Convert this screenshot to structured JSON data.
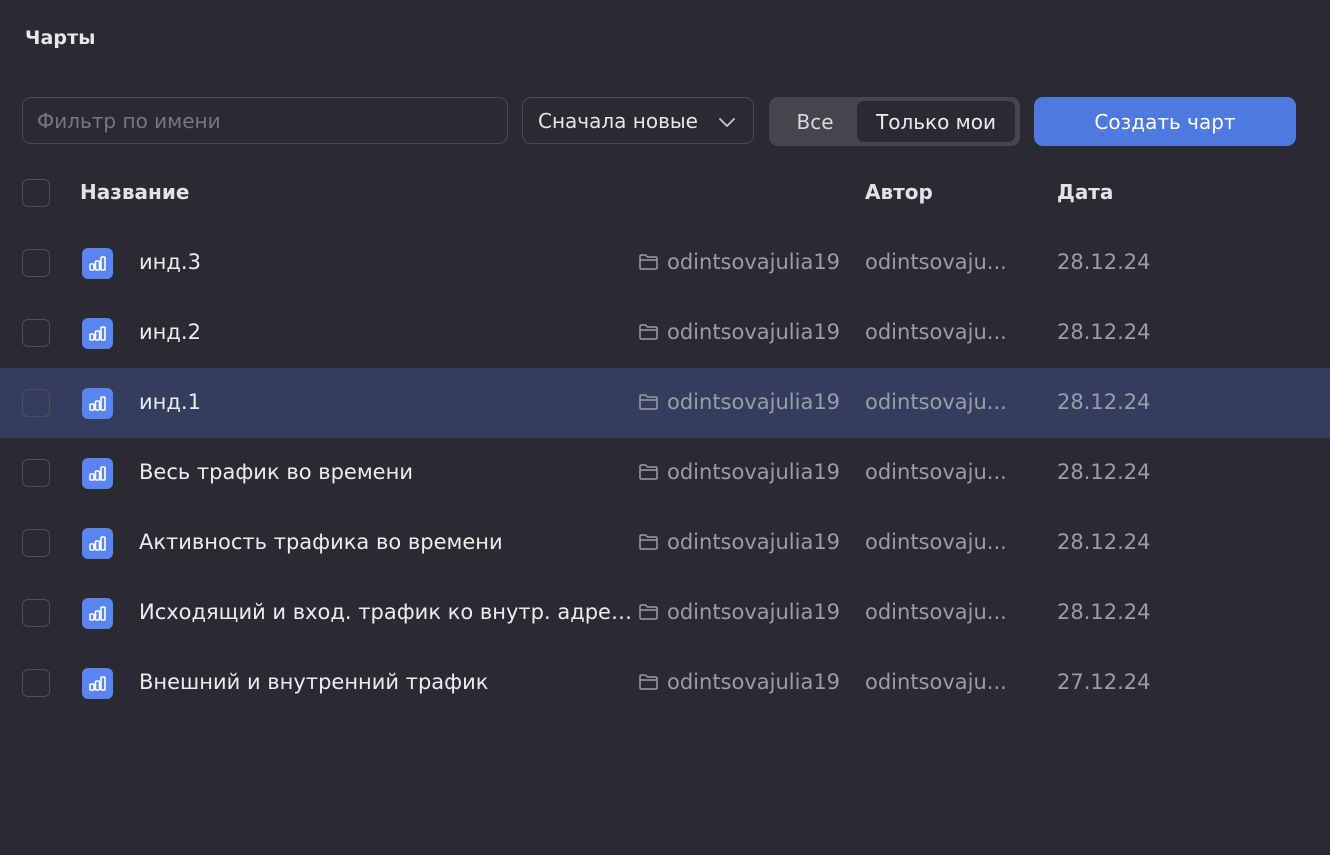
{
  "page": {
    "title": "Чарты"
  },
  "toolbar": {
    "filter_placeholder": "Фильтр по имени",
    "filter_value": "",
    "sort_selected": "Сначала новые",
    "segment_all": "Все",
    "segment_mine": "Только мои",
    "segment_active": "Только мои",
    "create_label": "Создать чарт",
    "accent_color": "#4e7ae0"
  },
  "table": {
    "headers": {
      "name": "Название",
      "author": "Автор",
      "date": "Дата"
    },
    "rows": [
      {
        "name": "инд.3",
        "folder": "odintsovajulia19",
        "author": "odintsovaju...",
        "date": "28.12.24",
        "selected": false
      },
      {
        "name": "инд.2",
        "folder": "odintsovajulia19",
        "author": "odintsovaju...",
        "date": "28.12.24",
        "selected": false
      },
      {
        "name": "инд.1",
        "folder": "odintsovajulia19",
        "author": "odintsovaju...",
        "date": "28.12.24",
        "selected": true
      },
      {
        "name": "Весь трафик во времени",
        "folder": "odintsovajulia19",
        "author": "odintsovaju...",
        "date": "28.12.24",
        "selected": false
      },
      {
        "name": "Активность трафика во времени",
        "folder": "odintsovajulia19",
        "author": "odintsovaju...",
        "date": "28.12.24",
        "selected": false
      },
      {
        "name": "Исходящий и вход. трафик ко внутр. адресам...",
        "folder": "odintsovajulia19",
        "author": "odintsovaju...",
        "date": "28.12.24",
        "selected": false
      },
      {
        "name": "Внешний и внутренний трафик",
        "folder": "odintsovajulia19",
        "author": "odintsovaju...",
        "date": "27.12.24",
        "selected": false
      }
    ]
  },
  "icons": {
    "row_icon": "chart-icon",
    "folder_icon": "folder-icon",
    "sort_icon": "chevron-down-icon"
  }
}
